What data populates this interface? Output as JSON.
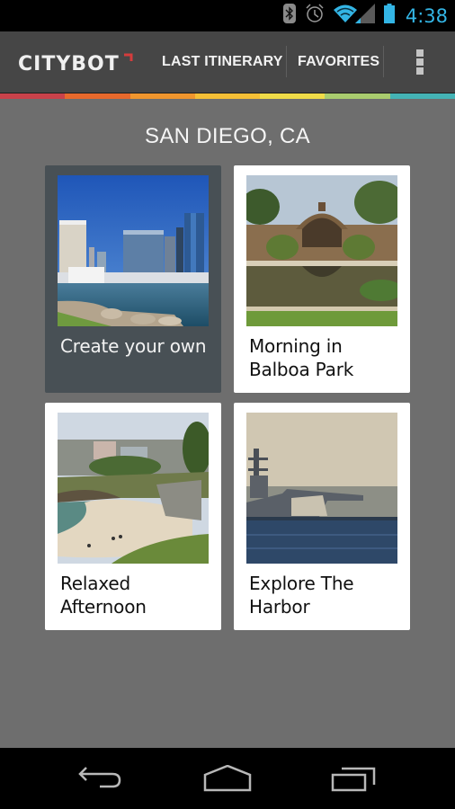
{
  "status_bar": {
    "time": "4:38",
    "icons": [
      "bluetooth-icon",
      "alarm-icon",
      "wifi-icon",
      "cell-signal-icon",
      "battery-icon"
    ],
    "accent_color": "#33b5e5"
  },
  "action_bar": {
    "logo_text": "CITYBOT",
    "menu": [
      {
        "label": "LAST ITINERARY"
      },
      {
        "label": "FAVORITES"
      }
    ],
    "overflow_icon": "overflow-menu-icon"
  },
  "color_strip": [
    "#c9424a",
    "#e8692c",
    "#f0962e",
    "#f5bf36",
    "#f0dc48",
    "#a9cc6e",
    "#44b3b5"
  ],
  "content": {
    "city": "SAN DIEGO, CA",
    "cards": [
      {
        "label": "Create your own",
        "image": "san-diego-marina-skyline",
        "selected": true
      },
      {
        "label": "Morning in Balboa Park",
        "image": "balboa-park-botanical-building",
        "selected": false
      },
      {
        "label": "Relaxed Afternoon",
        "image": "la-jolla-beach",
        "selected": false
      },
      {
        "label": "Explore The Harbor",
        "image": "aircraft-carrier-harbor",
        "selected": false
      }
    ]
  },
  "nav_bar": {
    "buttons": [
      "back-icon",
      "home-icon",
      "recent-apps-icon"
    ]
  }
}
